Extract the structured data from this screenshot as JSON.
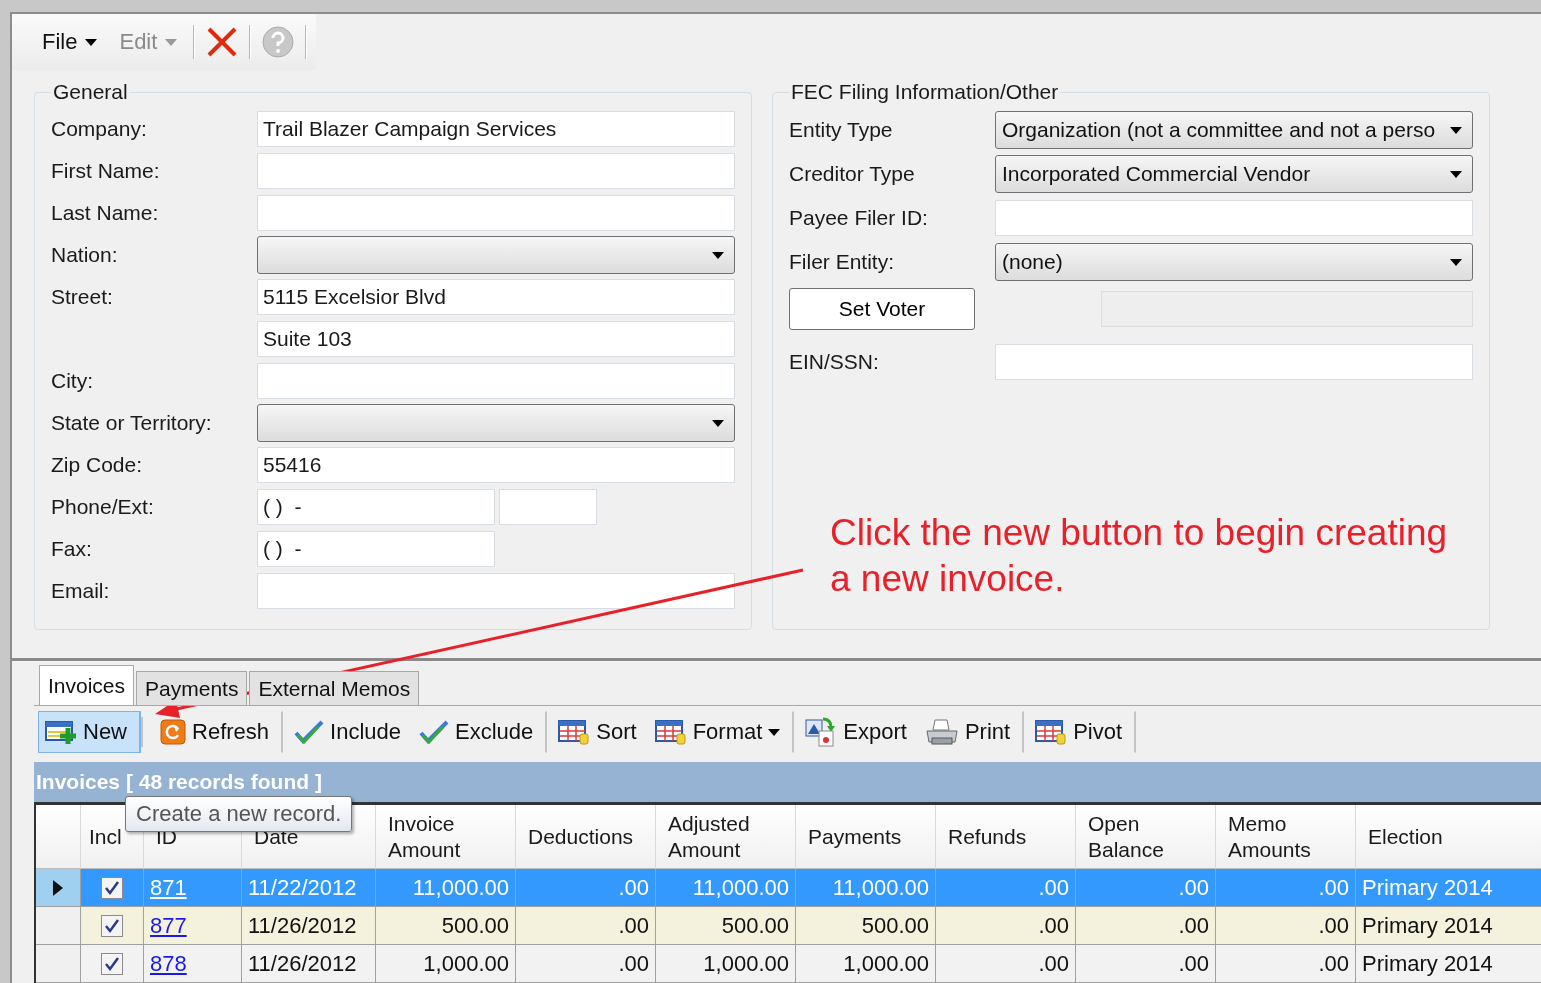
{
  "toolbar": {
    "menus": [
      {
        "label": "File",
        "disabled": false
      },
      {
        "label": "Edit",
        "disabled": true
      }
    ],
    "actions": [
      {
        "kind": "delete",
        "disabled": false
      },
      {
        "kind": "help",
        "disabled": true
      }
    ]
  },
  "general": {
    "title": "General",
    "fields": [
      {
        "label": "Company:",
        "kind": "text",
        "value": "Trail Blazer Campaign Services"
      },
      {
        "label": "First Name:",
        "kind": "text"
      },
      {
        "label": "Last Name:",
        "kind": "text"
      },
      {
        "label": "Nation:",
        "kind": "select"
      },
      {
        "label": "Street:",
        "kind": "text",
        "value": "5115 Excelsior Blvd"
      },
      {
        "kind": "text",
        "value": "Suite 103"
      },
      {
        "label": "City:",
        "kind": "text"
      },
      {
        "label": "State or Territory:",
        "kind": "select"
      },
      {
        "label": "Zip Code:",
        "kind": "text",
        "value": "55416"
      },
      {
        "label": "Phone/Ext:",
        "kind": "phone",
        "value": "( )  -"
      },
      {
        "label": "Fax:",
        "kind": "short",
        "value": "( )  -"
      },
      {
        "label": "Email:",
        "kind": "text"
      }
    ]
  },
  "fec": {
    "title": "FEC Filing Information/Other",
    "fields": [
      {
        "label": "Entity Type",
        "kind": "select",
        "value": "Organization (not a committee and not a perso"
      },
      {
        "label": "Creditor Type",
        "kind": "select",
        "value": "Incorporated Commercial Vendor"
      },
      {
        "label": "Payee Filer ID:",
        "kind": "text"
      },
      {
        "label": "Filer Entity:",
        "kind": "select",
        "value": "(none)"
      },
      {
        "label": "Set Voter",
        "kind": "button"
      },
      {
        "label": "EIN/SSN:",
        "kind": "text"
      }
    ]
  },
  "annotation": {
    "text": "Click the new button to begin creating a new invoice."
  },
  "tabs": [
    {
      "label": "Invoices",
      "selected": true
    },
    {
      "label": "Payments",
      "selected": false
    },
    {
      "label": "External Memos",
      "selected": false
    }
  ],
  "grid_toolbar": [
    {
      "label": "New",
      "kind": "add",
      "hovered": true,
      "separator_after": true
    },
    {
      "label": "Refresh",
      "kind": "refresh",
      "hovered": false,
      "separator_after": true
    },
    {
      "label": "Include",
      "kind": "check",
      "hovered": false
    },
    {
      "label": "Exclude",
      "kind": "check",
      "hovered": false,
      "separator_after": true
    },
    {
      "label": "Sort",
      "kind": "table",
      "hovered": false
    },
    {
      "label": "Format",
      "kind": "table",
      "hovered": false,
      "dropdown": true,
      "separator_after": true
    },
    {
      "label": "Export",
      "kind": "export",
      "hovered": false
    },
    {
      "label": "Print",
      "kind": "print",
      "hovered": false,
      "separator_after": true
    },
    {
      "label": "Pivot",
      "kind": "table",
      "hovered": false,
      "separator_after": true
    }
  ],
  "grid": {
    "title": "Invoices [ 48 records found ]",
    "tooltip": "Create a new record.",
    "checkbox_column": "Incl",
    "columns": [
      "ID",
      "Date",
      "Invoice Amount",
      "Deductions",
      "Adjusted Amount",
      "Payments",
      "Refunds",
      "Open Balance",
      "Memo Amounts",
      "Election"
    ],
    "rows": [
      {
        "selected": true,
        "included": true,
        "cells": [
          "871",
          "11/22/2012",
          "11,000.00",
          ".00",
          "11,000.00",
          "11,000.00",
          ".00",
          ".00",
          ".00",
          "Primary 2014"
        ]
      },
      {
        "selected": false,
        "included": true,
        "cells": [
          "877",
          "11/26/2012",
          "500.00",
          ".00",
          "500.00",
          "500.00",
          ".00",
          ".00",
          ".00",
          "Primary 2014"
        ]
      },
      {
        "selected": false,
        "included": true,
        "cells": [
          "878",
          "11/26/2012",
          "1,000.00",
          ".00",
          "1,000.00",
          "1,000.00",
          ".00",
          ".00",
          ".00",
          "Primary 2014"
        ]
      }
    ]
  }
}
